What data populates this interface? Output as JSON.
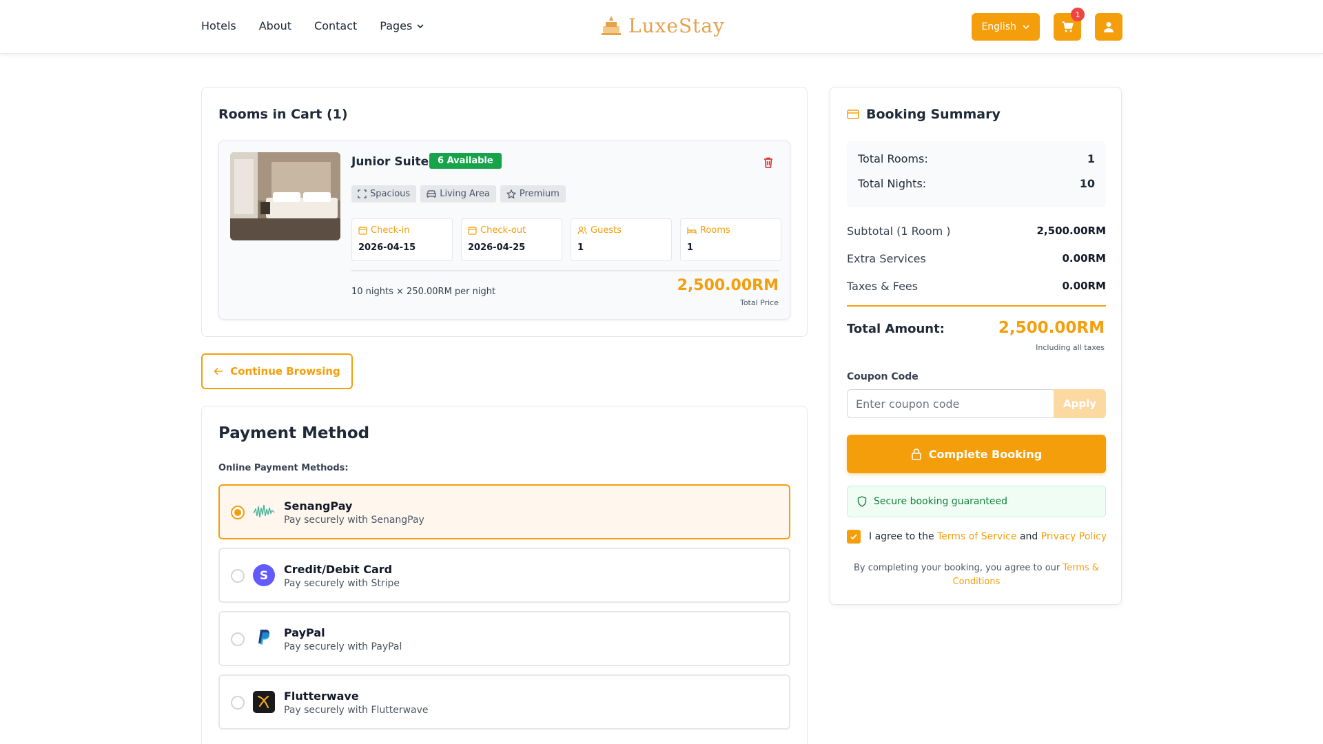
{
  "header": {
    "nav": [
      "Hotels",
      "About",
      "Contact",
      "Pages"
    ],
    "logo": "LuxeStay",
    "language": "English",
    "cart_count": "1"
  },
  "cart": {
    "title": "Rooms in Cart (1)",
    "room": {
      "name": "Junior Suite",
      "availability": "6 Available",
      "tags": [
        "Spacious",
        "Living Area",
        "Premium"
      ],
      "checkin_label": "Check-in",
      "checkin": "2026-04-15",
      "checkout_label": "Check-out",
      "checkout": "2026-04-25",
      "guests_label": "Guests",
      "guests": "1",
      "rooms_label": "Rooms",
      "rooms": "1",
      "per_night": "10 nights × 250.00RM per night",
      "total_price": "2,500.00RM",
      "total_price_label": "Total Price"
    },
    "continue_label": "Continue Browsing"
  },
  "payment": {
    "title": "Payment Method",
    "subtitle": "Online Payment Methods:",
    "methods": [
      {
        "name": "SenangPay",
        "desc": "Pay securely with SenangPay"
      },
      {
        "name": "Credit/Debit Card",
        "desc": "Pay securely with Stripe"
      },
      {
        "name": "PayPal",
        "desc": "Pay securely with PayPal"
      },
      {
        "name": "Flutterwave",
        "desc": "Pay securely with Flutterwave"
      }
    ]
  },
  "summary": {
    "title": "Booking Summary",
    "total_rooms_label": "Total Rooms:",
    "total_rooms": "1",
    "total_nights_label": "Total Nights:",
    "total_nights": "10",
    "subtotal_label": "Subtotal (1 Room )",
    "subtotal": "2,500.00RM",
    "extra_label": "Extra Services",
    "extra": "0.00RM",
    "taxes_label": "Taxes & Fees",
    "taxes": "0.00RM",
    "total_label": "Total Amount:",
    "total": "2,500.00RM",
    "total_note": "Including all taxes",
    "coupon_label": "Coupon Code",
    "coupon_placeholder": "Enter coupon code",
    "apply_label": "Apply",
    "complete_label": "Complete Booking",
    "secure_label": "Secure booking guaranteed",
    "agree_prefix": "I agree to the",
    "terms_service": "Terms of Service",
    "agree_and": "and",
    "privacy": "Privacy Policy",
    "footer_prefix": "By completing your booking, you agree to our",
    "footer_link": "Terms & Conditions"
  },
  "colors": {
    "accent": "#f59e0b",
    "success": "#16a34a",
    "danger": "#ef4444"
  }
}
